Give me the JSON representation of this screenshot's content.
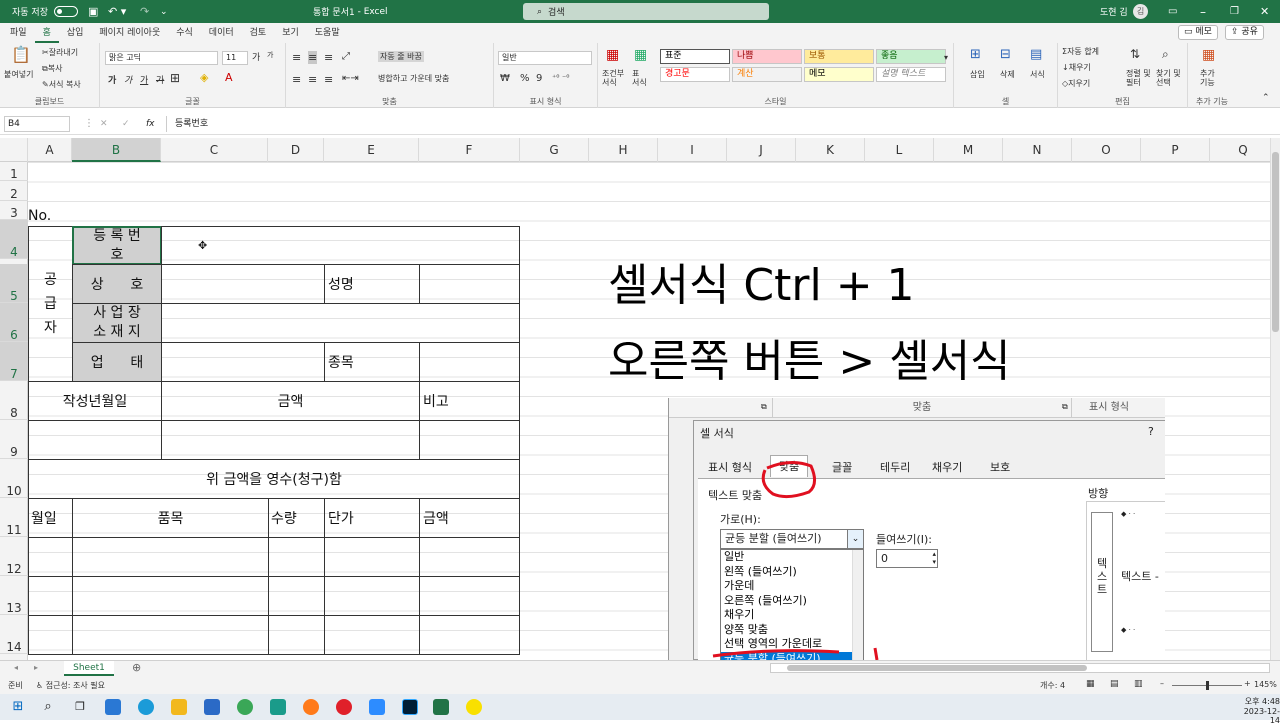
{
  "titlebar": {
    "autosave": "자동 저장",
    "autosave_state": "끔",
    "file_title": "통합 문서1",
    "app_name": "Excel",
    "search_placeholder": "검색",
    "user": "도현 김",
    "avatar_initial": "김"
  },
  "ribbon_tabs": [
    "파일",
    "홈",
    "삽입",
    "페이지 레이아웃",
    "수식",
    "데이터",
    "검토",
    "보기",
    "도움말"
  ],
  "ribbon_right": {
    "memo": "메모",
    "share": "공유"
  },
  "clipboard": {
    "paste": "붙여넣기",
    "cut": "잘라내기",
    "copy": "복사",
    "format_painter": "서식 복사",
    "label": "클립보드"
  },
  "font": {
    "name": "맑은 고딕",
    "size": "11",
    "bold": "가",
    "italic": "가",
    "underline": "가",
    "strike": "가",
    "label": "글꼴",
    "grow": "가",
    "shrink": "가"
  },
  "align": {
    "wrap": "자동 줄 바꿈",
    "merge": "병합하고 가운데 맞춤",
    "label": "맞춤"
  },
  "number": {
    "format": "일반",
    "pct": "%",
    "comma": "9",
    "label": "표시 형식"
  },
  "styles": {
    "cond": "조건부\n서식",
    "table": "표\n서식",
    "label": "스타일",
    "items": [
      {
        "name": "표준",
        "bg": "#ffffff",
        "fg": "#000000"
      },
      {
        "name": "나쁨",
        "bg": "#ffc7ce",
        "fg": "#9c0006"
      },
      {
        "name": "보통",
        "bg": "#ffeb9c",
        "fg": "#9c5700"
      },
      {
        "name": "좋음",
        "bg": "#c6efce",
        "fg": "#006100"
      },
      {
        "name": "경고문",
        "bg": "#ffffff",
        "fg": "#ff0000"
      },
      {
        "name": "계산",
        "bg": "#f2f2f2",
        "fg": "#fa7d00"
      },
      {
        "name": "메모",
        "bg": "#ffffcc",
        "fg": "#000000"
      },
      {
        "name": "설명 텍스트",
        "bg": "#ffffff",
        "fg": "#7f7f7f"
      }
    ]
  },
  "cells_group": {
    "insert": "삽입",
    "delete": "삭제",
    "format": "서식",
    "label": "셀"
  },
  "editing": {
    "autosum": "자동 합계",
    "fill": "채우기",
    "clear": "지우기",
    "sort": "정렬 및\n필터",
    "find": "찾기 및\n선택",
    "label": "편집"
  },
  "addins": {
    "label": "추가\n기능",
    "group": "추가 기능"
  },
  "formula_bar": {
    "namebox": "B4",
    "fx": "fx",
    "content": "등록번호"
  },
  "columns": [
    {
      "id": "A",
      "w": 44
    },
    {
      "id": "B",
      "w": 89
    },
    {
      "id": "C",
      "w": 107
    },
    {
      "id": "D",
      "w": 56
    },
    {
      "id": "E",
      "w": 95
    },
    {
      "id": "F",
      "w": 101
    },
    {
      "id": "G",
      "w": 69
    },
    {
      "id": "H",
      "w": 69
    },
    {
      "id": "I",
      "w": 69
    },
    {
      "id": "J",
      "w": 69
    },
    {
      "id": "K",
      "w": 69
    },
    {
      "id": "L",
      "w": 69
    },
    {
      "id": "M",
      "w": 69
    },
    {
      "id": "N",
      "w": 69
    },
    {
      "id": "O",
      "w": 69
    },
    {
      "id": "P",
      "w": 69
    },
    {
      "id": "Q",
      "w": 67
    }
  ],
  "rows": [
    "1",
    "2",
    "3",
    "4",
    "5",
    "6",
    "7",
    "8",
    "9",
    "10",
    "11",
    "12",
    "13",
    "14"
  ],
  "form": {
    "no": "No.",
    "supplier": "공\n급\n자",
    "reg_no": "등 록 번\n호",
    "company": "상      호",
    "address": "사 업 장\n소 재 지",
    "business": "업      태",
    "name": "성명",
    "item_type": "종목",
    "date": "작성년월일",
    "amount": "금액",
    "remark": "비고",
    "receipt": "위 금액을 영수(청구)함",
    "month_day": "월일",
    "product": "품목",
    "qty": "수량",
    "unit_price": "단가",
    "total": "금액"
  },
  "annotation": {
    "line1": "셀서식  Ctrl + 1",
    "line2": "오른쪽 버튼 > 셀서식"
  },
  "dialog": {
    "top_align": "맞춤",
    "top_number": "표시 형식",
    "title": "셀 서식",
    "help": "?",
    "tabs": [
      "표시 형식",
      "맞춤",
      "글꼴",
      "테두리",
      "채우기",
      "보호"
    ],
    "text_align": "텍스트 맞춤",
    "horizontal": "가로(H):",
    "horizontal_value": "균등 분할 (들여쓰기)",
    "indent": "들여쓰기(I):",
    "indent_value": "0",
    "orientation": "방향",
    "vertical_text": "텍\n스\n트",
    "text_label": "텍스트 -",
    "options": [
      "일반",
      "왼쪽 (들여쓰기)",
      "가운데",
      "오른쪽 (들여쓰기)",
      "채우기",
      "양쪽 맞춤",
      "선택 영역의 가운데로",
      "균등 분할 (들여쓰기)"
    ]
  },
  "sheet_tab": "Sheet1",
  "status": {
    "ready": "준비",
    "accessibility": "접근성: 조사 필요",
    "count": "개수: 4",
    "zoom": "145%"
  },
  "taskbar": {
    "time": "오후 4:48",
    "date": "2023-12-14"
  }
}
